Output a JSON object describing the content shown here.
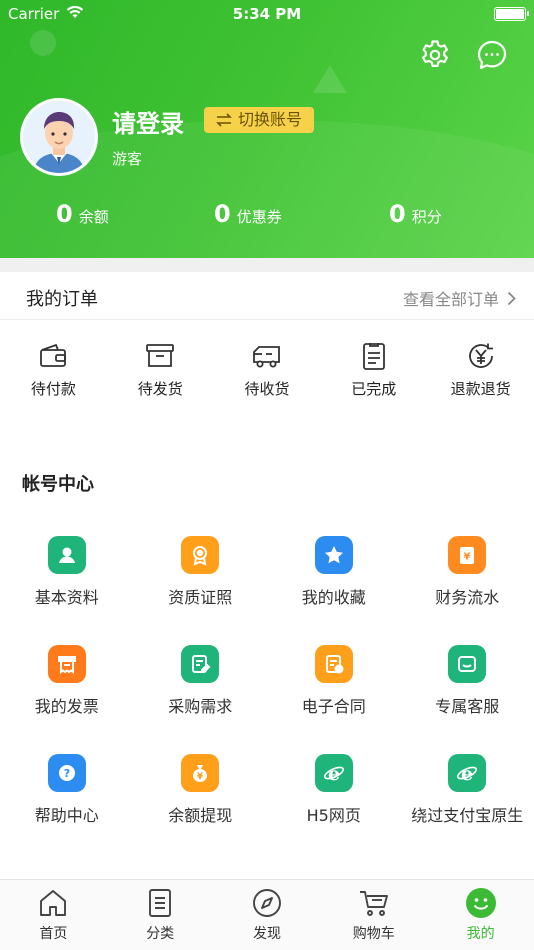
{
  "status_bar": {
    "carrier": "Carrier",
    "time": "5:34 PM"
  },
  "profile": {
    "login_title": "请登录",
    "switch_account": "切换账号",
    "guest_label": "游客"
  },
  "stats": [
    {
      "value": "0",
      "label": "余额"
    },
    {
      "value": "0",
      "label": "优惠券"
    },
    {
      "value": "0",
      "label": "积分"
    }
  ],
  "orders": {
    "title": "我的订单",
    "view_all": "查看全部订单",
    "items": [
      {
        "label": "待付款",
        "icon": "wallet-icon"
      },
      {
        "label": "待发货",
        "icon": "box-icon"
      },
      {
        "label": "待收货",
        "icon": "truck-icon"
      },
      {
        "label": "已完成",
        "icon": "document-icon"
      },
      {
        "label": "退款退货",
        "icon": "refund-icon"
      }
    ]
  },
  "account_center": {
    "title": "帐号中心",
    "items": [
      {
        "label": "基本资料",
        "icon": "user-icon",
        "color": "#1fb57a"
      },
      {
        "label": "资质证照",
        "icon": "certificate-icon",
        "color": "#ff9f1a"
      },
      {
        "label": "我的收藏",
        "icon": "star-icon",
        "color": "#2d8cf0"
      },
      {
        "label": "财务流水",
        "icon": "finance-icon",
        "color": "#ff8a1f"
      },
      {
        "label": "我的发票",
        "icon": "invoice-icon",
        "color": "#ff7a1a"
      },
      {
        "label": "采购需求",
        "icon": "purchase-icon",
        "color": "#1fb57a"
      },
      {
        "label": "电子合同",
        "icon": "contract-icon",
        "color": "#ff9f1a"
      },
      {
        "label": "专属客服",
        "icon": "chat-icon",
        "color": "#1fb57a"
      },
      {
        "label": "帮助中心",
        "icon": "help-icon",
        "color": "#2d8cf0"
      },
      {
        "label": "余额提现",
        "icon": "withdraw-icon",
        "color": "#ff9f1a"
      },
      {
        "label": "H5网页",
        "icon": "browser-icon",
        "color": "#1fb57a"
      },
      {
        "label": "绕过支付宝原生",
        "icon": "browser-icon",
        "color": "#1fb57a"
      }
    ]
  },
  "tabbar": {
    "items": [
      {
        "label": "首页",
        "icon": "home-icon"
      },
      {
        "label": "分类",
        "icon": "list-icon"
      },
      {
        "label": "发现",
        "icon": "compass-icon"
      },
      {
        "label": "购物车",
        "icon": "cart-icon"
      },
      {
        "label": "我的",
        "icon": "smile-icon"
      }
    ],
    "active_color": "#3cb935"
  },
  "colors": {
    "header_green": "#3fc233",
    "badge_yellow": "#f6d24a"
  }
}
